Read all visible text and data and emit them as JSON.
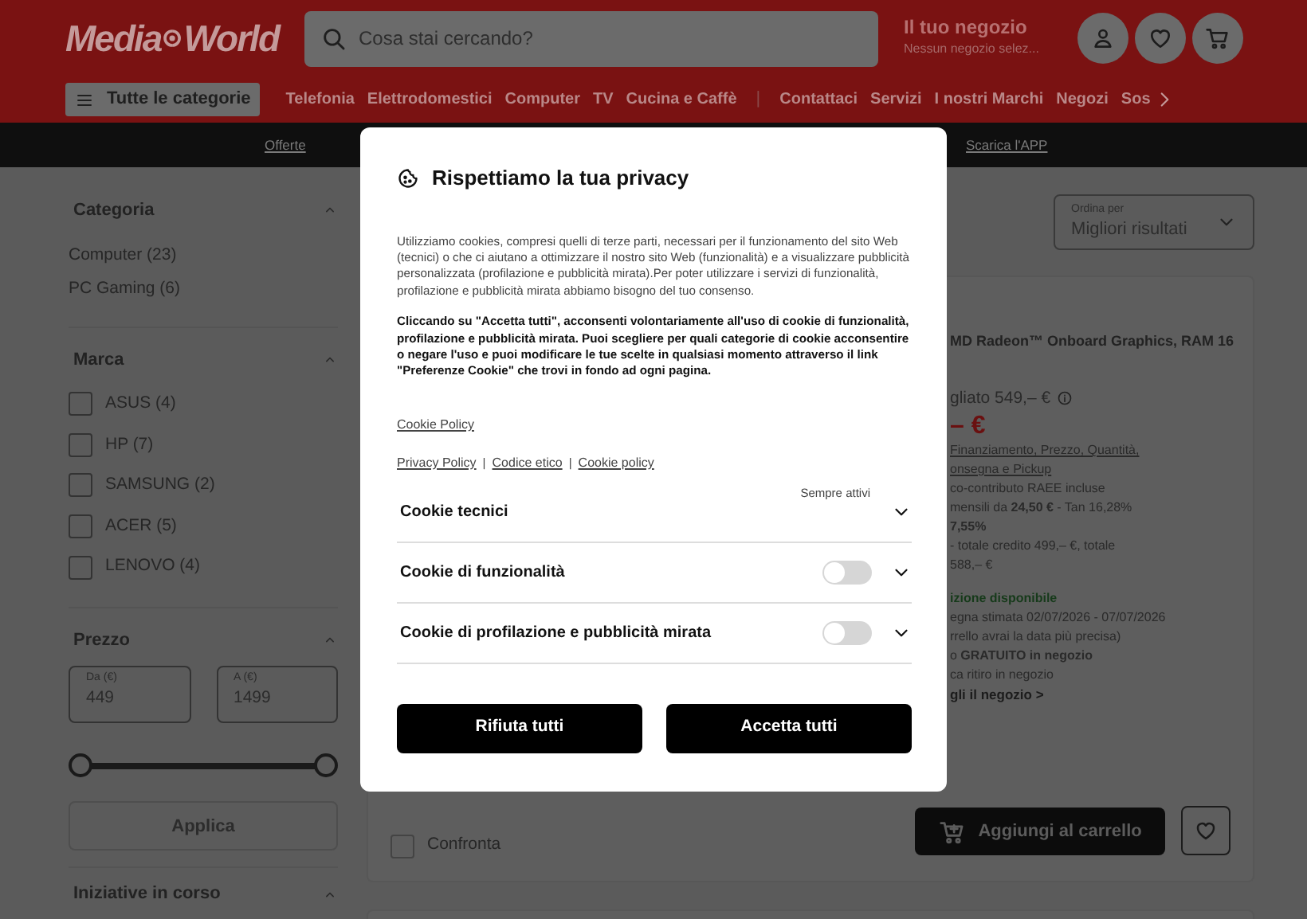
{
  "header": {
    "logo": [
      "Media",
      "World"
    ],
    "search": {
      "placeholder": "Cosa stai cercando?"
    },
    "store": {
      "title": "Il tuo negozio",
      "subtitle": "Nessun negozio selez..."
    }
  },
  "nav": {
    "menu_button": "Tutte le categorie",
    "items": [
      {
        "kind": "link",
        "label": "Telefonia"
      },
      {
        "kind": "link",
        "label": "Elettrodomestici"
      },
      {
        "kind": "link",
        "label": "Computer"
      },
      {
        "kind": "link",
        "label": "TV"
      },
      {
        "kind": "link",
        "label": "Cucina e Caffè"
      },
      {
        "kind": "divider",
        "label": "|"
      },
      {
        "kind": "link",
        "label": "Contattaci"
      },
      {
        "kind": "link",
        "label": "Servizi"
      },
      {
        "kind": "link",
        "label": "I nostri Marchi"
      },
      {
        "kind": "link",
        "label": "Negozi"
      },
      {
        "kind": "link",
        "label": "Sos"
      }
    ]
  },
  "promo_bar": [
    "Offerte",
    "Scarica l'APP"
  ],
  "filters": [
    {
      "kind": "links",
      "title": "Categoria",
      "expanded": true,
      "items": [
        "Computer (23)",
        "PC Gaming (6)"
      ]
    },
    {
      "kind": "checkboxes",
      "title": "Marca",
      "expanded": true,
      "items": [
        {
          "label": "ASUS (4)",
          "checked": false
        },
        {
          "label": "HP (7)",
          "checked": false
        },
        {
          "label": "SAMSUNG (2)",
          "checked": false
        },
        {
          "label": "ACER (5)",
          "checked": false
        },
        {
          "label": "LENOVO (4)",
          "checked": false
        }
      ]
    },
    {
      "kind": "price",
      "title": "Prezzo",
      "expanded": true,
      "from": {
        "label": "Da (€)",
        "value": "449"
      },
      "to": {
        "label": "A (€)",
        "value": "1499"
      },
      "thumbs": [
        {
          "level": 0
        },
        {
          "level": 1
        }
      ],
      "apply": {
        "label": "Applica",
        "disabled": true
      }
    },
    {
      "kind": "header",
      "title": "Iniziative in corso",
      "expanded": true
    }
  ],
  "sort": {
    "label": "Ordina per",
    "value": "Migliori risultati"
  },
  "product": {
    "lines": [
      {
        "kind": "title",
        "text": "MD Radeon™ Onboard Graphics, RAM 16"
      },
      {
        "kind": "list_price",
        "text": "gliato 549,– €"
      },
      {
        "kind": "price",
        "text": "– €"
      },
      {
        "kind": "link",
        "text": "Finanziamento, Prezzo, Quantità,"
      },
      {
        "kind": "link",
        "text": "onsegna e Pickup"
      },
      {
        "kind": "note",
        "text": "co-contributo RAEE incluse"
      },
      {
        "kind": "note",
        "text": "mensili da **24,50 €** - Tan 16,28%"
      },
      {
        "kind": "note",
        "text": "**7,55%**"
      },
      {
        "kind": "note",
        "text": "- totale credito 499,– €, totale"
      },
      {
        "kind": "note",
        "text": "588,– €"
      },
      {
        "kind": "availability",
        "text": "izione disponibile"
      },
      {
        "kind": "note",
        "text": "egna stimata 02/07/2026 - 07/07/2026"
      },
      {
        "kind": "note",
        "text": "rrello avrai la data più precisa)"
      },
      {
        "kind": "note",
        "text": "o **GRATUITO in negozio**"
      },
      {
        "kind": "note",
        "text": "ca ritiro in negozio"
      },
      {
        "kind": "strong",
        "text": "gli il negozio >"
      }
    ],
    "compare": {
      "label": "Confronta",
      "checked": false
    },
    "add_to_cart": "Aggiungi al carrello"
  },
  "privacy_dialog": {
    "title": "Rispettiamo la tua privacy",
    "paragraphs": [
      {
        "kind": "plain",
        "text": "Utilizziamo cookies, compresi quelli di terze parti, necessari per il funzionamento del sito Web (tecnici) o che ci aiutano a ottimizzare il nostro sito Web (funzionalità) e a visualizzare pubblicità personalizzata (profilazione e pubblicità mirata).Per poter utilizzare i servizi di funzionalità, profilazione e pubblicità mirata abbiamo bisogno del tuo consenso."
      },
      {
        "kind": "bold",
        "text": "Cliccando su \"Accetta tutti\", acconsenti volontariamente all'uso di cookie di funzionalità, profilazione e pubblicità mirata. Puoi scegliere per quali categorie di cookie acconsentire o negare l'uso e puoi modificare le tue scelte in qualsiasi momento attraverso il link \"Preferenze Cookie\" che trovi in fondo ad ogni pagina."
      }
    ],
    "policy_link": "Cookie Policy",
    "links": [
      "Privacy Policy",
      "Codice etico",
      "Cookie policy"
    ],
    "separator": "|",
    "categories": [
      {
        "kind": "always",
        "label": "Cookie tecnici",
        "note": "Sempre attivi",
        "expanded": false
      },
      {
        "kind": "toggle",
        "label": "Cookie di funzionalità",
        "on": false,
        "expanded": false
      },
      {
        "kind": "toggle",
        "label": "Cookie di profilazione e pubblicità mirata",
        "on": false,
        "expanded": false
      }
    ],
    "buttons": [
      "Rifiuta tutti",
      "Accetta tutti"
    ]
  }
}
